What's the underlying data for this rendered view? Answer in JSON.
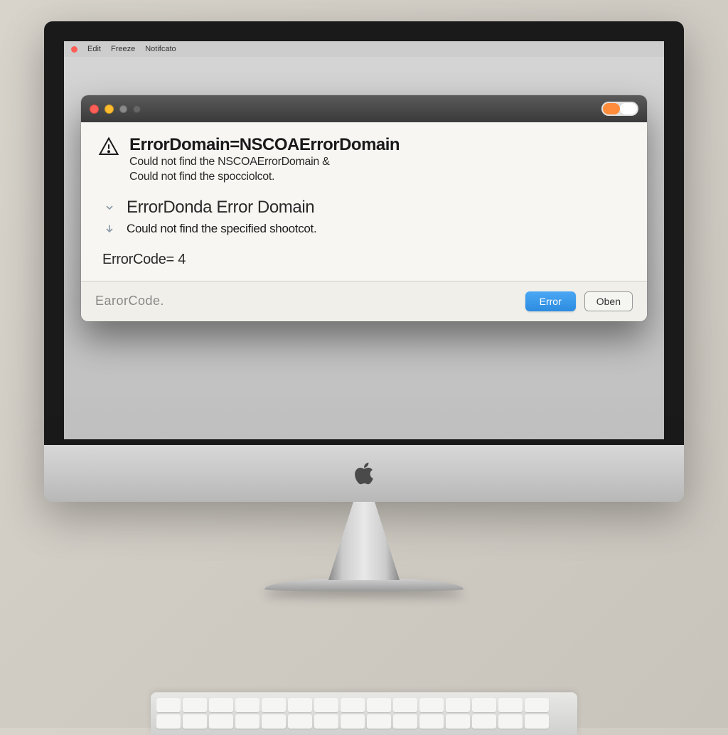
{
  "menubar": {
    "items": [
      "Edit",
      "Freeze",
      "Notifcato"
    ]
  },
  "dialog": {
    "heading": "ErrorDomain=NSCOAErrorDomain",
    "line1": "Could not find the NSCOAErrorDomain &",
    "line2": "Could not find the spocciolcot.",
    "section2_heading": "ErrorDonda Error  Domain",
    "section2_sub": "Could not find the specified shootcot.",
    "errorcode": "ErrorCode= 4",
    "footer_label": "EarorCode.",
    "btn_primary": "Error",
    "btn_secondary": "Oben"
  }
}
